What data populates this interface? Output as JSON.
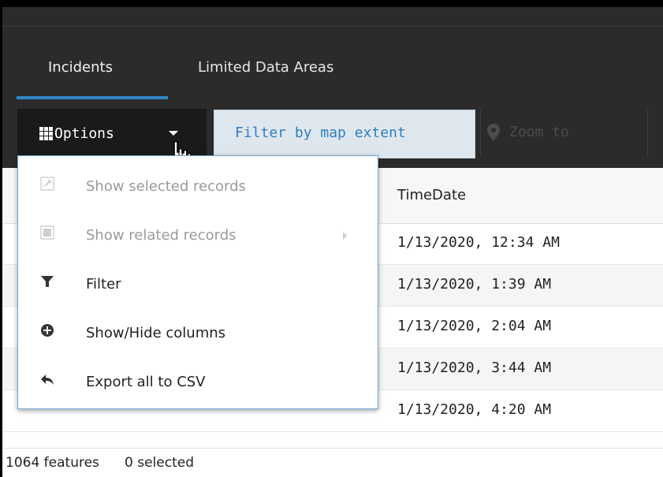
{
  "tabs": [
    {
      "label": "Incidents",
      "active": true
    },
    {
      "label": "Limited Data Areas",
      "active": false
    }
  ],
  "toolbar": {
    "options_label": "Options",
    "filter_label": "Filter by map extent",
    "zoom_label": "Zoom to"
  },
  "table": {
    "column_header": "TimeDate",
    "rows": [
      "1/13/2020, 12:34 AM",
      "1/13/2020, 1:39 AM",
      "1/13/2020, 2:04 AM",
      "1/13/2020, 3:44 AM",
      "1/13/2020, 4:20 AM"
    ]
  },
  "menu": {
    "items": [
      {
        "label": "Show selected records",
        "icon": "pin-icon",
        "enabled": false
      },
      {
        "label": "Show related records",
        "icon": "square-icon",
        "enabled": false,
        "has_submenu": true
      },
      {
        "label": "Filter",
        "icon": "filter-icon",
        "enabled": true
      },
      {
        "label": "Show/Hide columns",
        "icon": "plus-circle-icon",
        "enabled": true
      },
      {
        "label": "Export all to CSV",
        "icon": "share-arrow-icon",
        "enabled": true
      }
    ]
  },
  "status": {
    "features": "1064 features",
    "selected": "0 selected"
  },
  "colors": {
    "accent": "#2f86c8",
    "toolbar_bg": "#2b2b2b",
    "filter_text": "#2f7fc1",
    "disabled_text": "#9a9a9a"
  }
}
